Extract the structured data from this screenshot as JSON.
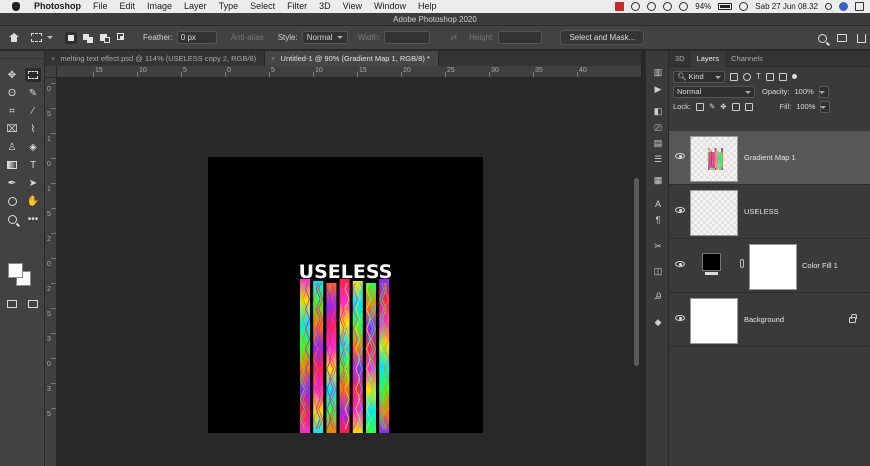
{
  "menubar": {
    "app": "Photoshop",
    "items": [
      "File",
      "Edit",
      "Image",
      "Layer",
      "Type",
      "Select",
      "Filter",
      "3D",
      "View",
      "Window",
      "Help"
    ],
    "battery": "94%",
    "datetime": "Sab 27 Jun  08.32"
  },
  "window_title": "Adobe Photoshop 2020",
  "options": {
    "feather_label": "Feather:",
    "feather_value": "0 px",
    "antialias_label": "Anti-alias",
    "style_label": "Style:",
    "style_value": "Normal",
    "width_label": "Width:",
    "height_label": "Height:",
    "select_mask_button": "Select and Mask..."
  },
  "tabs": [
    {
      "label": "melting text effect.psd @ 114% (USELESS copy 2, RGB/8)",
      "active": false
    },
    {
      "label": "Untitled-1 @ 90% (Gradient Map 1, RGB/8) *",
      "active": true
    }
  ],
  "rulers": {
    "h": [
      "15",
      "10",
      "5",
      "0",
      "5",
      "10",
      "15",
      "20",
      "25",
      "30",
      "35",
      "40"
    ],
    "v": [
      "0",
      "5",
      "1",
      "0",
      "1",
      "5",
      "2",
      "0",
      "2",
      "5",
      "3",
      "0",
      "3",
      "5"
    ]
  },
  "canvas": {
    "text": "USELESS",
    "background": "#000000",
    "stripe_colors": [
      "#ff2bd6",
      "#ffe100",
      "#00e5ff",
      "#35ff2f",
      "#ff7a00",
      "#8a2bff",
      "#ff1f4f"
    ]
  },
  "panel": {
    "tabs": [
      "3D",
      "Layers",
      "Channels"
    ],
    "active_tab": "Layers",
    "kind_label": "Kind",
    "blend_mode": "Normal",
    "opacity_label": "Opacity:",
    "opacity_value": "100%",
    "lock_label": "Lock:",
    "fill_label": "Fill:",
    "fill_value": "100%",
    "layers": [
      {
        "name": "Gradient Map 1",
        "selected": true
      },
      {
        "name": "USELESS",
        "selected": false
      },
      {
        "name": "Color Fill 1",
        "selected": false
      },
      {
        "name": "Background",
        "selected": false,
        "locked": true
      }
    ]
  },
  "colors": {
    "menubar": "#ececec",
    "ui_dark": "#424242",
    "panel": "#3a3a3a",
    "selected_layer": "#575757",
    "canvas_bg": "#282828"
  }
}
